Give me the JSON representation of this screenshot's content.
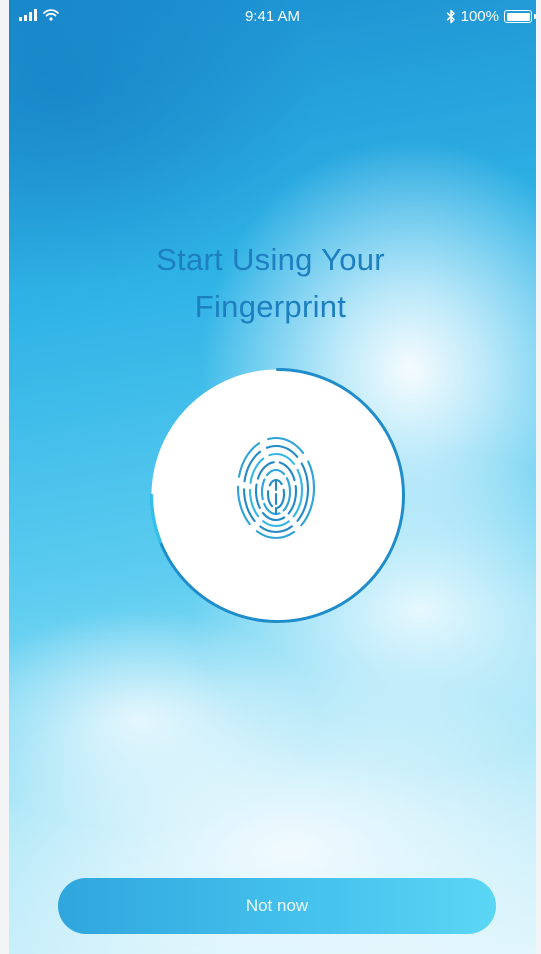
{
  "status_bar": {
    "time": "9:41 AM",
    "battery": "100%",
    "icons": [
      "signal-icon",
      "wifi-icon",
      "bluetooth-icon",
      "battery-icon"
    ]
  },
  "title_line1": "Start Using Your",
  "title_line2": "Fingerprint",
  "fingerprint": {
    "icon": "fingerprint-icon",
    "scan_progress": 0.75
  },
  "not_now_button": "Not now",
  "colors": {
    "accent": "#1d7fc0",
    "ring": "#1f8ccb",
    "button": "#46c3ee",
    "background_top": "#1b8fd0",
    "background_bottom": "#dff5fc"
  }
}
